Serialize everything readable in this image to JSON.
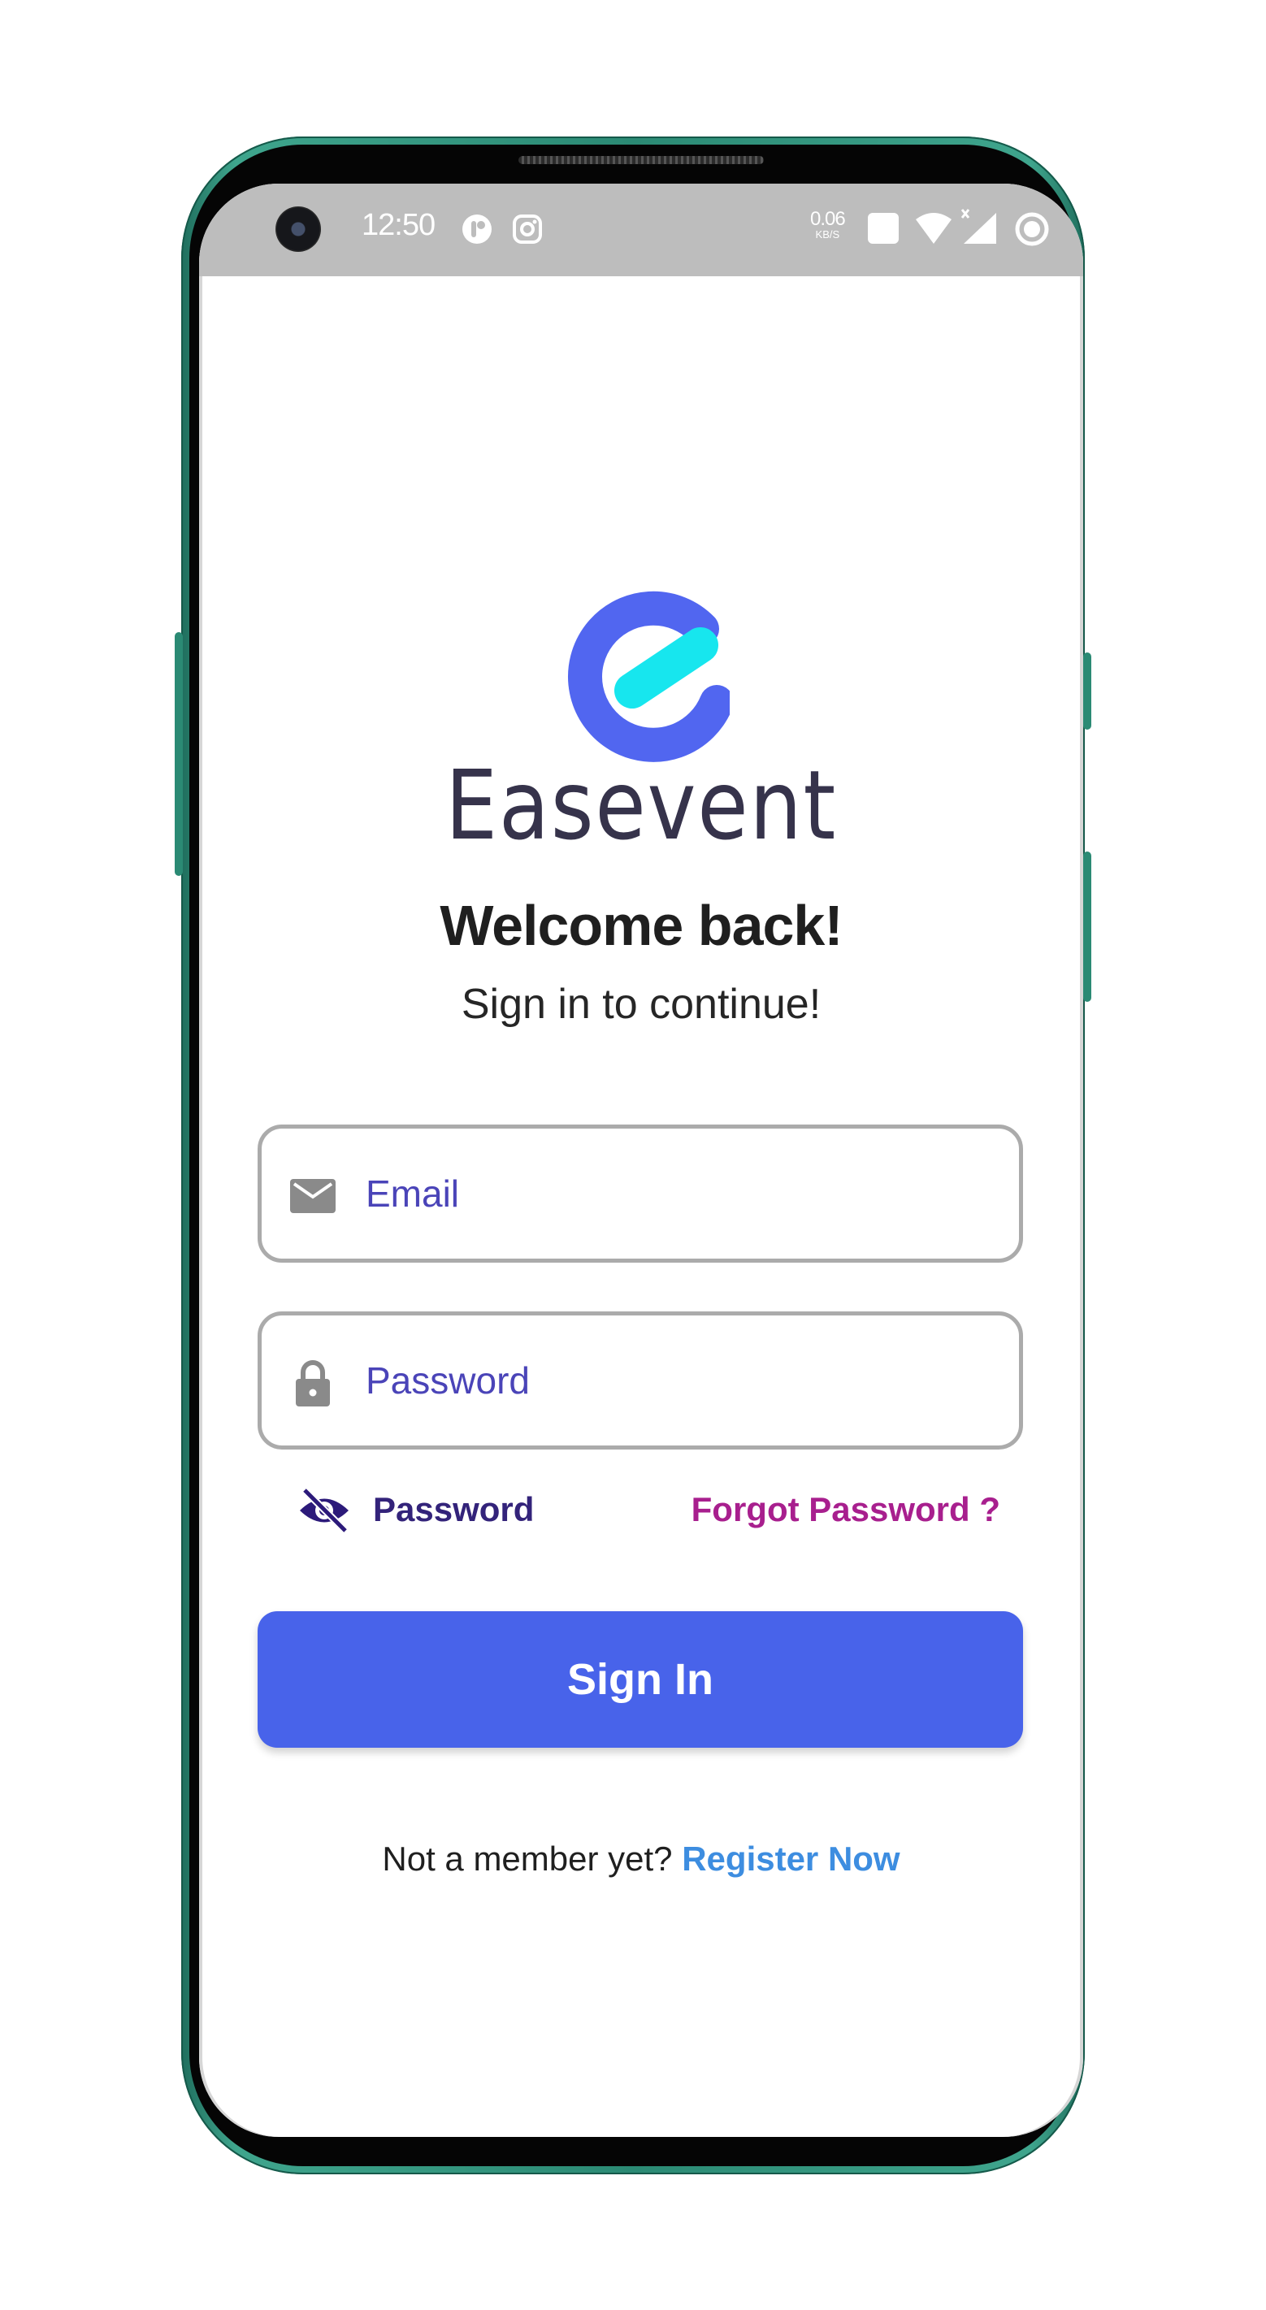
{
  "status_bar": {
    "time": "12:50",
    "net_speed_value": "0.06",
    "net_speed_unit": "KB/S",
    "icons": [
      "app-notification-icon",
      "instagram-icon",
      "volte-icon",
      "wifi-icon",
      "cell-signal-icon",
      "battery-saver-icon"
    ]
  },
  "app": {
    "name": "Easevent",
    "logo": "easevent-logo",
    "brand_colors": {
      "logo_primary": "#5166f0",
      "logo_accent": "#17e6ee"
    }
  },
  "header": {
    "title": "Welcome back!",
    "subtitle": "Sign in to continue!"
  },
  "form": {
    "email": {
      "placeholder": "Email",
      "value": "",
      "icon": "envelope-icon"
    },
    "password": {
      "placeholder": "Password",
      "value": "",
      "icon": "lock-icon"
    },
    "show_password": {
      "label": "Password",
      "icon": "eye-off-icon"
    },
    "forgot_password": "Forgot Password ?",
    "submit_label": "Sign In"
  },
  "footer": {
    "prompt": "Not a member yet?",
    "register_link": "Register Now"
  },
  "colors": {
    "primary_button": "#4863ea",
    "input_text": "#3f3bb0",
    "forgot_link": "#a81f8e",
    "register_link": "#3d8de0"
  }
}
